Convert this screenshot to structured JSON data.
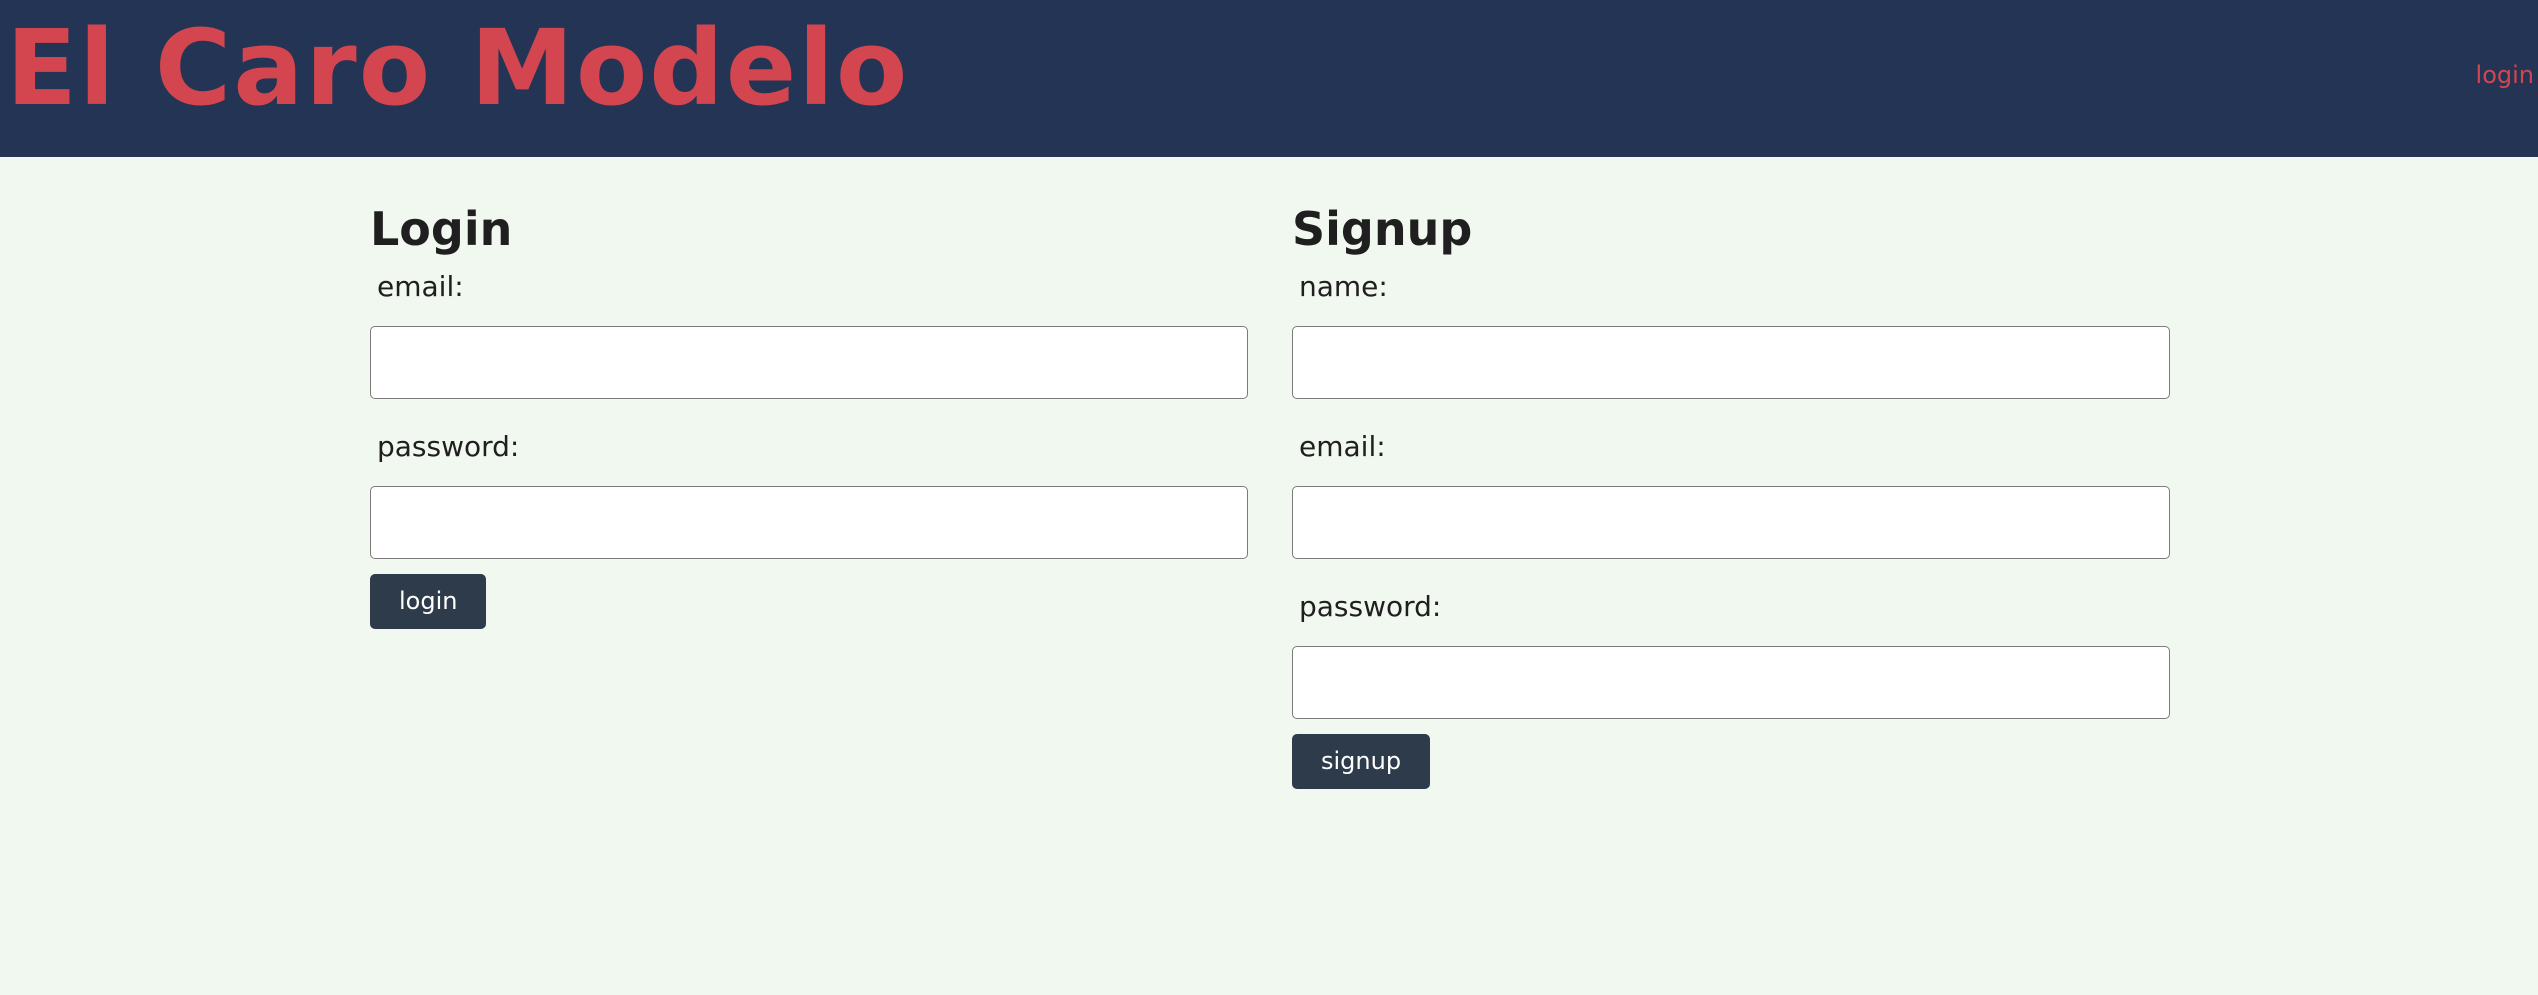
{
  "header": {
    "brand": "El Caro Modelo",
    "nav_login": "login"
  },
  "login": {
    "title": "Login",
    "email_label": "email:",
    "email_value": "",
    "password_label": "password:",
    "password_value": "",
    "button_label": "login"
  },
  "signup": {
    "title": "Signup",
    "name_label": "name:",
    "name_value": "",
    "email_label": "email:",
    "email_value": "",
    "password_label": "password:",
    "password_value": "",
    "button_label": "signup"
  },
  "colors": {
    "header_bg": "#233455",
    "accent": "#d3464f",
    "page_bg": "#f1f8ef",
    "button_bg": "#2e3b4b"
  }
}
